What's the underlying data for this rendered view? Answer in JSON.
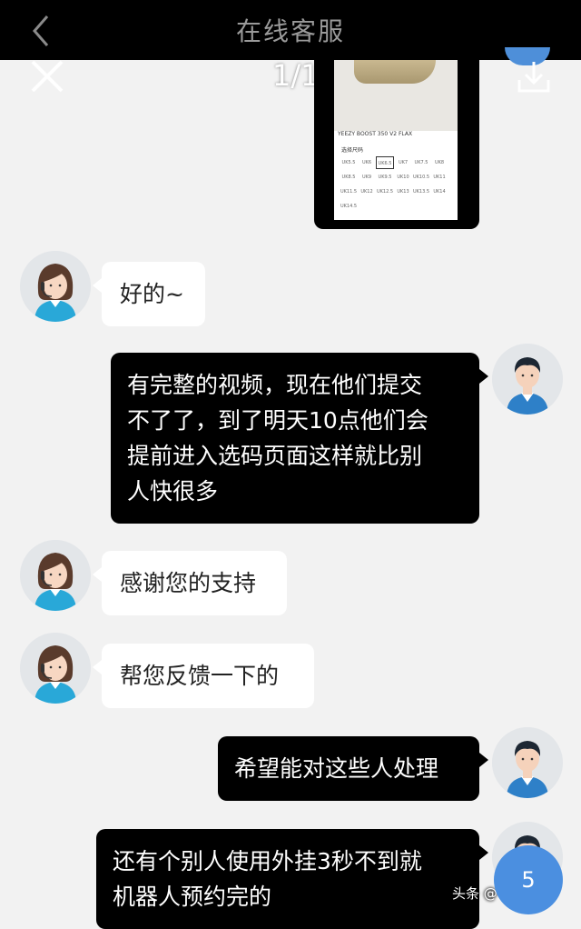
{
  "header": {
    "title": "在线客服"
  },
  "viewer": {
    "counter": "1/1"
  },
  "screenshot": {
    "caption": "YEEZY BOOST 350 V2 FLAX",
    "label": "选择尺码",
    "sizes": [
      "UK5.5",
      "UK6",
      "UK6.5",
      "UK7",
      "UK7.5",
      "UK8",
      "UK8.5",
      "UK9",
      "UK9.5",
      "UK10",
      "UK10.5",
      "UK11",
      "UK11.5",
      "UK12",
      "UK12.5",
      "UK13",
      "UK13.5",
      "UK14",
      "UK14.5"
    ],
    "selected_index": 2
  },
  "messages": [
    {
      "side": "in",
      "lines": [
        "好的~"
      ]
    },
    {
      "side": "out",
      "lines": [
        "有完整的视频，现在他们提交",
        "不了了，到了明天10点他们会",
        "提前进入选码页面这样就比别",
        "人快很多"
      ]
    },
    {
      "side": "in",
      "lines": [
        "感谢您的支持"
      ]
    },
    {
      "side": "in",
      "lines": [
        "帮您反馈一下的"
      ]
    },
    {
      "side": "out",
      "lines": [
        "希望能对这些人处理"
      ]
    },
    {
      "side": "out",
      "lines": [
        "还有个别人使用外挂3秒不到就",
        "机器人预约完的"
      ]
    }
  ],
  "watermark": "头条 @一点潮鞋",
  "fab": {
    "count": "5"
  },
  "colors": {
    "agent_shirt": "#29a8d8",
    "user_shirt": "#2e80c8",
    "fab": "#4b8fe0"
  }
}
